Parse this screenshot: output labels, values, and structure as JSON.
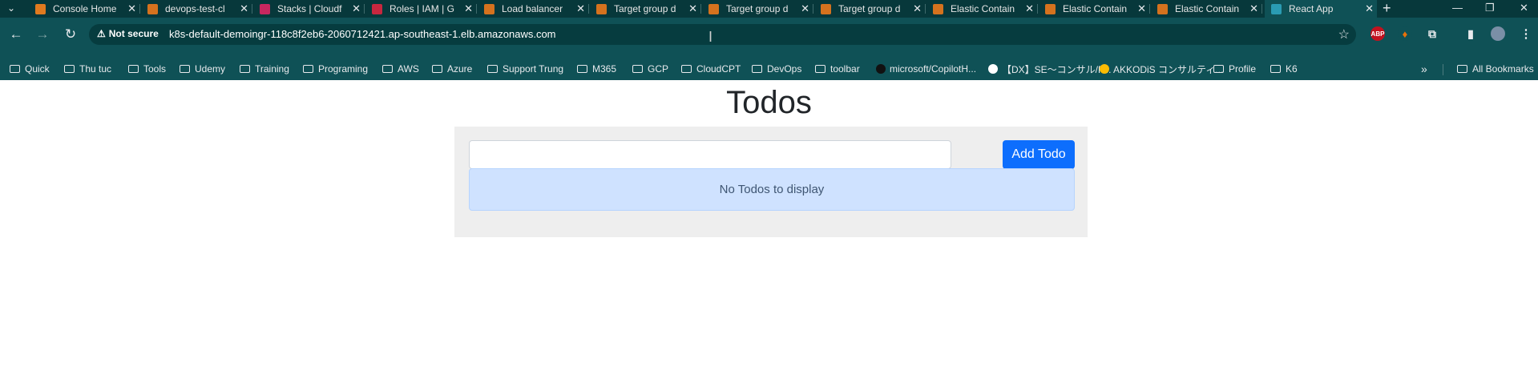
{
  "browser": {
    "tabs": [
      {
        "title": "Console Home",
        "favicon_color": "#e07a1f",
        "active": false
      },
      {
        "title": "devops-test-cl",
        "favicon_color": "#d5721e",
        "active": false
      },
      {
        "title": "Stacks | Cloudf",
        "favicon_color": "#c7275f",
        "active": false
      },
      {
        "title": "Roles | IAM | G",
        "favicon_color": "#c7273f",
        "active": false
      },
      {
        "title": "Load balancer",
        "favicon_color": "#d5721e",
        "active": false
      },
      {
        "title": "Target group d",
        "favicon_color": "#d5721e",
        "active": false
      },
      {
        "title": "Target group d",
        "favicon_color": "#d5721e",
        "active": false
      },
      {
        "title": "Target group d",
        "favicon_color": "#d5721e",
        "active": false
      },
      {
        "title": "Elastic Contain",
        "favicon_color": "#d5721e",
        "active": false
      },
      {
        "title": "Elastic Contain",
        "favicon_color": "#d5721e",
        "active": false
      },
      {
        "title": "Elastic Contain",
        "favicon_color": "#d5721e",
        "active": false
      },
      {
        "title": "React App",
        "favicon_color": "#2a9bb3",
        "active": true
      }
    ],
    "security_label": "Not secure",
    "url": "k8s-default-demoingr-118c8f2eb6-2060712421.ap-southeast-1.elb.amazonaws.com",
    "extensions": [
      {
        "label": "ABP",
        "color": "#c1121f"
      },
      {
        "label": "",
        "color": "#e8710a"
      }
    ],
    "bookmarks": [
      {
        "label": "Quick",
        "type": "folder"
      },
      {
        "label": "Thu tuc",
        "type": "folder"
      },
      {
        "label": "Tools",
        "type": "folder"
      },
      {
        "label": "Udemy",
        "type": "folder"
      },
      {
        "label": "Training",
        "type": "folder"
      },
      {
        "label": "Programing",
        "type": "folder"
      },
      {
        "label": "AWS",
        "type": "folder"
      },
      {
        "label": "Azure",
        "type": "folder"
      },
      {
        "label": "Support Trung",
        "type": "folder"
      },
      {
        "label": "M365",
        "type": "folder"
      },
      {
        "label": "GCP",
        "type": "folder"
      },
      {
        "label": "CloudCPT",
        "type": "folder"
      },
      {
        "label": "DevOps",
        "type": "folder"
      },
      {
        "label": "toolbar",
        "type": "folder"
      },
      {
        "label": "microsoft/CopilotH...",
        "type": "link",
        "icon_color": "#111111"
      },
      {
        "label": "【DX】SE〜コンサル/P...",
        "type": "link",
        "icon_color": "#ffffff"
      },
      {
        "label": "AKKODiS コンサルティ...",
        "type": "link",
        "icon_color": "#fbbc04"
      },
      {
        "label": "Profile",
        "type": "folder"
      },
      {
        "label": "K6",
        "type": "folder"
      }
    ],
    "all_bookmarks_label": "All Bookmarks"
  },
  "page": {
    "title": "Todos",
    "input_value": "",
    "add_button_label": "Add Todo",
    "empty_message": "No Todos to display"
  }
}
